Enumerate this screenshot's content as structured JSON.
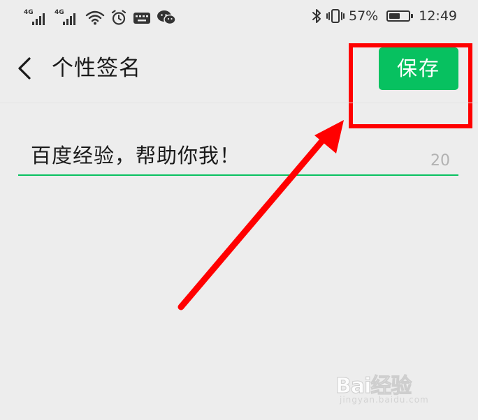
{
  "status_bar": {
    "signal_1_network": "4G",
    "signal_2_network": "4G",
    "battery_percent": "57%",
    "battery_level": 0.57,
    "time": "12:49",
    "icons": [
      "signal-icon",
      "signal-icon",
      "wifi-icon",
      "alarm-icon",
      "keyboard-icon",
      "wechat-icon",
      "bluetooth-icon",
      "vibrate-icon",
      "battery-icon"
    ]
  },
  "header": {
    "back_icon": "chevron-left-icon",
    "title": "个性签名",
    "save_label": "保存"
  },
  "signature": {
    "value": "百度经验，帮助你我！",
    "remaining_count": "20"
  },
  "watermark": {
    "logo_text": "Bai经验",
    "url": "jingyan.baidu.com"
  },
  "colors": {
    "accent": "#07c160",
    "annotation": "#ff0000",
    "background": "#ededed"
  }
}
